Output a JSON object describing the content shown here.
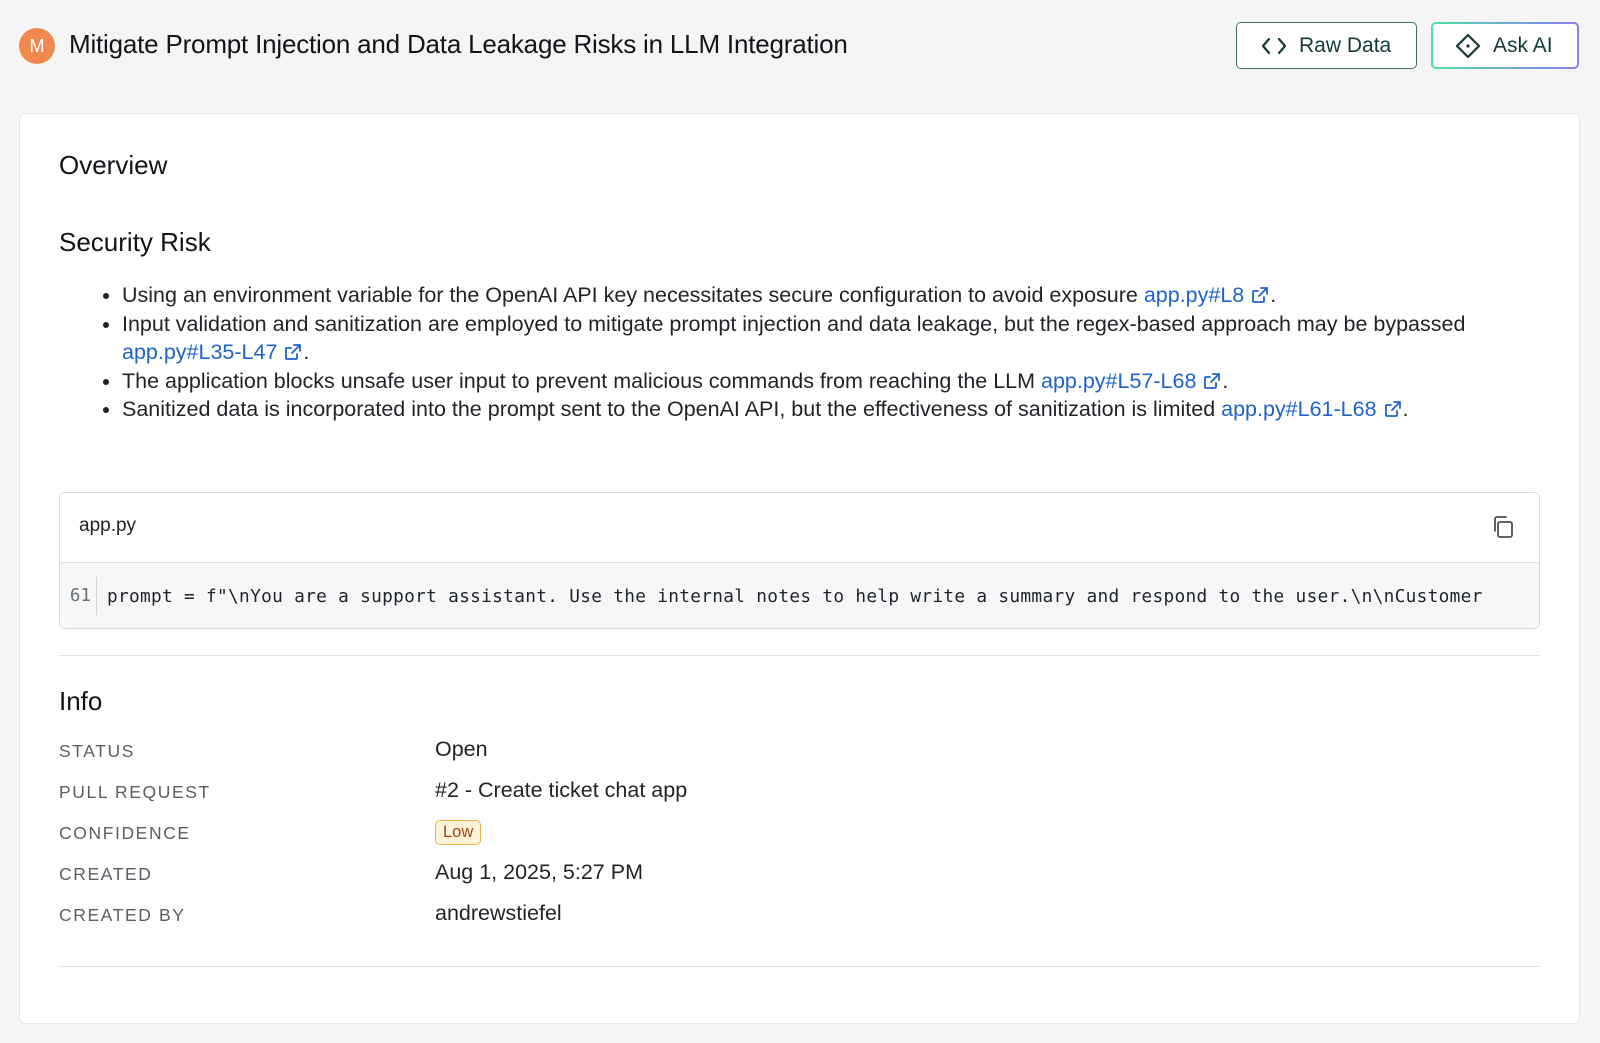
{
  "header": {
    "avatar_initial": "M",
    "title": "Mitigate Prompt Injection and Data Leakage Risks in LLM Integration",
    "raw_data_label": "Raw Data",
    "ask_ai_label": "Ask AI"
  },
  "overview": {
    "heading": "Overview",
    "risk_heading": "Security Risk",
    "bullets": [
      {
        "text": "Using an environment variable for the OpenAI API key necessitates secure configuration to avoid exposure ",
        "link": "app.py#L8"
      },
      {
        "text": "Input validation and sanitization are employed to mitigate prompt injection and data leakage, but the regex-based approach may be bypassed ",
        "link": "app.py#L35-L47"
      },
      {
        "text": "The application blocks unsafe user input to prevent malicious commands from reaching the LLM ",
        "link": "app.py#L57-L68"
      },
      {
        "text": "Sanitized data is incorporated into the prompt sent to the OpenAI API, but the effectiveness of sanitization is limited ",
        "link": "app.py#L61-L68"
      }
    ]
  },
  "code": {
    "filename": "app.py",
    "line_number": "61",
    "line_text": "prompt = f\"\\nYou are a support assistant. Use the internal notes to help write a summary and respond to the user.\\n\\nCustomer"
  },
  "info": {
    "heading": "Info",
    "status_label": "STATUS",
    "status_value": "Open",
    "pr_label": "PULL REQUEST",
    "pr_value": "#2 - Create ticket chat app",
    "confidence_label": "CONFIDENCE",
    "confidence_value": "Low",
    "created_label": "CREATED",
    "created_value": "Aug 1, 2025, 5:27 PM",
    "created_by_label": "CREATED BY",
    "created_by_value": "andrewstiefel"
  },
  "colors": {
    "avatar": "#f0894d",
    "link": "#1d63c9",
    "badge_low_text": "#a0461a",
    "badge_low_bg": "#fdf3d9",
    "badge_low_border": "#e9b44a",
    "raw_data_border": "#3f6f6b",
    "ask_ai_gradient_start": "#4ee0a8",
    "ask_ai_gradient_end": "#8b7cf0"
  },
  "icons": {
    "raw_data": "code-brackets-icon",
    "ask_ai": "diamond-sparkle-icon",
    "link": "external-link-icon",
    "copy": "copy-icon"
  }
}
